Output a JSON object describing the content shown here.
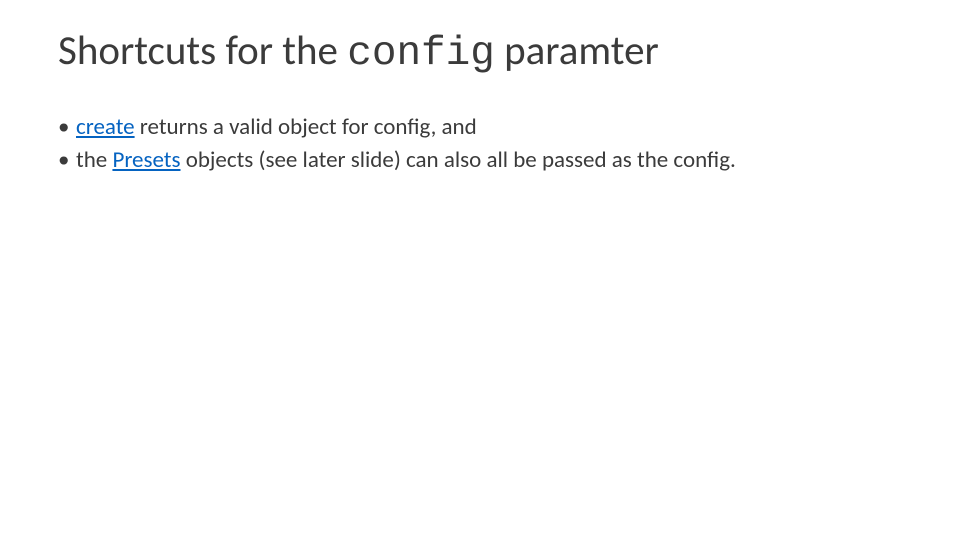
{
  "title": {
    "prefix": "Shortcuts for the ",
    "code": "config",
    "suffix": " paramter"
  },
  "bullets": [
    {
      "link": "create",
      "text": " returns a valid object for config, and"
    },
    {
      "pre": "the ",
      "link": "Presets",
      "text": " objects (see later slide) can also all be passed as the config."
    }
  ]
}
